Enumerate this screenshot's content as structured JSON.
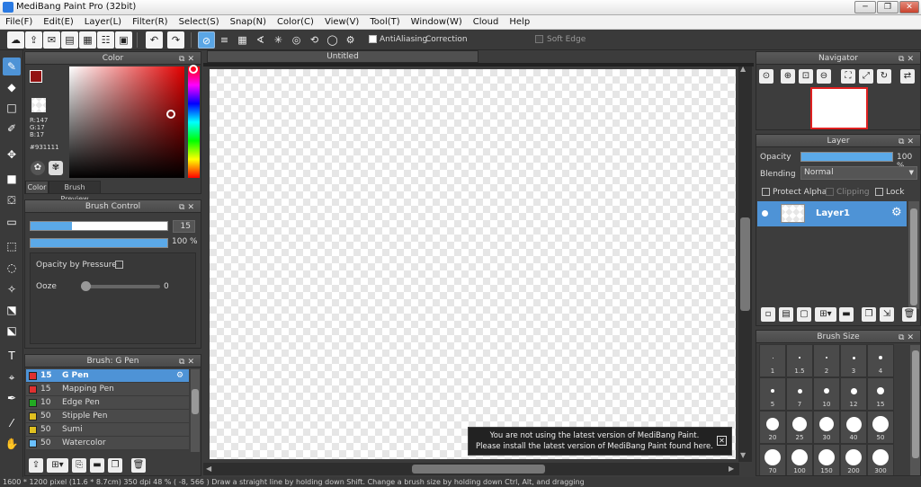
{
  "window": {
    "title": "MediBang Paint Pro (32bit)",
    "minimize": "─",
    "restore": "❐",
    "close": "✕"
  },
  "menu": [
    "File(F)",
    "Edit(E)",
    "Layer(L)",
    "Filter(R)",
    "Select(S)",
    "Snap(N)",
    "Color(C)",
    "View(V)",
    "Tool(T)",
    "Window(W)",
    "Cloud",
    "Help"
  ],
  "toolbar": {
    "antialiasing": "AntiAliasing",
    "correction_label": "Correction",
    "correction_value": "0",
    "soft_edge": "Soft Edge"
  },
  "color_panel": {
    "title": "Color",
    "primary": "#931111",
    "r": "R:147",
    "g": "G:17",
    "b": "B:17",
    "hex": "#931111",
    "tab_color": "Color",
    "tab_preview": "Brush Preview"
  },
  "brush_control": {
    "title": "Brush Control",
    "size": "15",
    "size_fraction": 0.3,
    "opacity": "100 %",
    "opacity_fraction": 1.0,
    "opacity_by_pressure": "Opacity by Pressure",
    "ooze_label": "Ooze",
    "ooze_value": "0"
  },
  "brush_list": {
    "title": "Brush: G Pen",
    "items": [
      {
        "size": "15",
        "name": "G Pen",
        "color": "#e03030"
      },
      {
        "size": "15",
        "name": "Mapping Pen",
        "color": "#e03030"
      },
      {
        "size": "10",
        "name": "Edge Pen",
        "color": "#22aa22"
      },
      {
        "size": "50",
        "name": "Stipple Pen",
        "color": "#e0c020"
      },
      {
        "size": "50",
        "name": "Sumi",
        "color": "#e0c020"
      },
      {
        "size": "50",
        "name": "Watercolor",
        "color": "#6ac0ff"
      }
    ]
  },
  "canvas": {
    "tab": "Untitled"
  },
  "notice": {
    "line1": "You are not using the latest version of MediBang Paint.",
    "line2": "Please install the latest version of MediBang Paint found here."
  },
  "navigator": {
    "title": "Navigator"
  },
  "layer_panel": {
    "title": "Layer",
    "opacity_label": "Opacity",
    "opacity_value": "100 %",
    "opacity_fraction": 1.0,
    "blending_label": "Blending",
    "blending_value": "Normal",
    "protect_alpha": "Protect Alpha",
    "clipping": "Clipping",
    "lock": "Lock",
    "layer_name": "Layer1"
  },
  "brush_size": {
    "title": "Brush Size",
    "sizes": [
      "1",
      "1.5",
      "2",
      "3",
      "4",
      "5",
      "7",
      "10",
      "12",
      "15",
      "20",
      "25",
      "30",
      "40",
      "50",
      "70",
      "100",
      "150",
      "200",
      "300"
    ]
  },
  "status": {
    "text": "1600 * 1200 pixel   (11.6 * 8.7cm)   350 dpi   48 %   ( -8, 566 )   Draw a straight line by holding down Shift. Change a brush size by holding down Ctrl, Alt, and dragging"
  }
}
